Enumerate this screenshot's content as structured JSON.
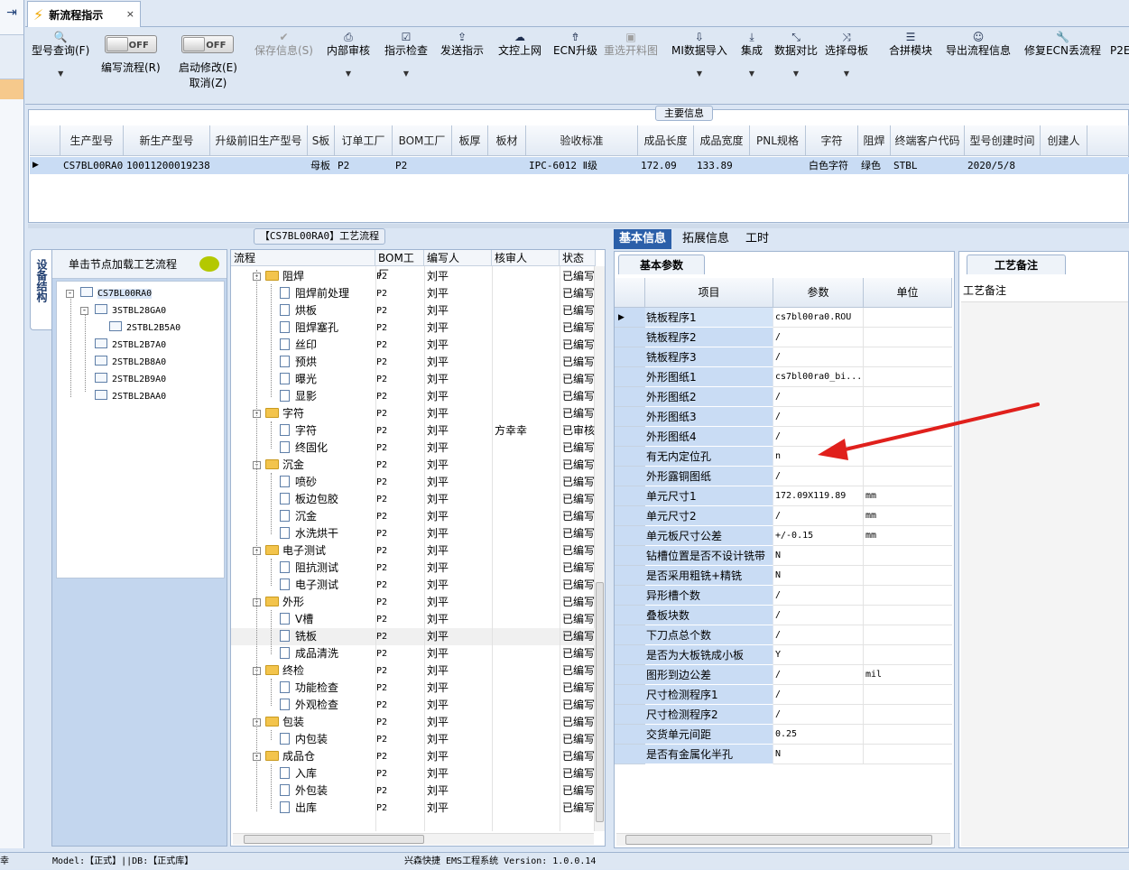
{
  "window": {
    "tab_title": "新流程指示",
    "tab_close": "×"
  },
  "toolbar": [
    {
      "label": "型号查询(F)",
      "icon": "search-icon",
      "glyph": "🔍",
      "arrow": true,
      "disabled": false
    },
    {
      "label": "编写流程(R)",
      "toggle": "OFF"
    },
    {
      "label": "启动修改(E)",
      "label2": "取消(Z)",
      "toggle": "OFF"
    },
    {
      "label": "保存信息(S)",
      "icon": "check-icon",
      "glyph": "✔",
      "disabled": true
    },
    {
      "label": "内部审核",
      "icon": "printer-icon",
      "glyph": "⎙",
      "arrow": true
    },
    {
      "label": "指示检查",
      "icon": "checklist-icon",
      "glyph": "☑",
      "arrow": true
    },
    {
      "label": "发送指示",
      "icon": "upload-icon",
      "glyph": "⇪"
    },
    {
      "label": "文控上网",
      "icon": "cloud-upload-icon",
      "glyph": "☁"
    },
    {
      "label": "ECN升级",
      "icon": "upgrade-icon",
      "glyph": "⇮"
    },
    {
      "label": "重选开料图",
      "icon": "image-icon",
      "glyph": "▣",
      "disabled": true
    },
    {
      "label": "MI数据导入",
      "icon": "download-icon",
      "glyph": "⇩",
      "arrow": true
    },
    {
      "label": "集成",
      "icon": "integrate-icon",
      "glyph": "⤓",
      "arrow": true
    },
    {
      "label": "数据对比",
      "icon": "compare-icon",
      "glyph": "⤡",
      "arrow": true
    },
    {
      "label": "选择母板",
      "icon": "shuffle-icon",
      "glyph": "⤨",
      "arrow": true
    },
    {
      "label": "合拼模块",
      "icon": "list-icon",
      "glyph": "☰"
    },
    {
      "label": "导出流程信息",
      "icon": "smile-icon",
      "glyph": "☺"
    },
    {
      "label": "修复ECN丢流程",
      "icon": "wrench-icon",
      "glyph": "🔧"
    },
    {
      "label": "P2E",
      "icon": "",
      "glyph": ""
    }
  ],
  "main_info": {
    "caption": "主要信息",
    "columns": [
      "生产型号",
      "新生产型号",
      "升级前旧生产型号",
      "S板",
      "订单工厂",
      "BOM工厂",
      "板厚",
      "板材",
      "验收标准",
      "成品长度",
      "成品宽度",
      "PNL规格",
      "字符",
      "阻焊",
      "终端客户代码",
      "型号创建时间",
      "创建人"
    ],
    "row": [
      "CS7BL00RA0",
      "10011200019238",
      "",
      "母板",
      "P2",
      "P2",
      "",
      "",
      "IPC-6012 Ⅱ级",
      "172.09",
      "133.89",
      "",
      "白色字符",
      "绿色",
      "STBL",
      "2020/5/8",
      ""
    ]
  },
  "left_pane": {
    "vertical_tab": "设备结构",
    "header": "单击节点加载工艺流程",
    "tree": [
      {
        "label": "CS7BL00RA0",
        "level": 0,
        "expander": "-",
        "selected": true
      },
      {
        "label": "3STBL28GA0",
        "level": 1,
        "expander": "-"
      },
      {
        "label": "2STBL2B5A0",
        "level": 2
      },
      {
        "label": "2STBL2B7A0",
        "level": 1
      },
      {
        "label": "2STBL2B8A0",
        "level": 1
      },
      {
        "label": "2STBL2B9A0",
        "level": 1
      },
      {
        "label": "2STBL2BAA0",
        "level": 1
      }
    ]
  },
  "process": {
    "caption": "【CS7BL00RA0】工艺流程",
    "columns": [
      "流程",
      "BOM工厂",
      "编写人",
      "核审人",
      "状态"
    ],
    "rows": [
      {
        "name": "阻焊",
        "folder": true,
        "bom": "P2",
        "writer": "刘平",
        "checker": "",
        "status": "已编写"
      },
      {
        "name": "阻焊前处理",
        "bom": "P2",
        "writer": "刘平",
        "checker": "",
        "status": "已编写"
      },
      {
        "name": "烘板",
        "bom": "P2",
        "writer": "刘平",
        "checker": "",
        "status": "已编写"
      },
      {
        "name": "阻焊塞孔",
        "bom": "P2",
        "writer": "刘平",
        "checker": "",
        "status": "已编写"
      },
      {
        "name": "丝印",
        "bom": "P2",
        "writer": "刘平",
        "checker": "",
        "status": "已编写"
      },
      {
        "name": "预烘",
        "bom": "P2",
        "writer": "刘平",
        "checker": "",
        "status": "已编写"
      },
      {
        "name": "曝光",
        "bom": "P2",
        "writer": "刘平",
        "checker": "",
        "status": "已编写"
      },
      {
        "name": "显影",
        "bom": "P2",
        "writer": "刘平",
        "checker": "",
        "status": "已编写"
      },
      {
        "name": "字符",
        "folder": true,
        "bom": "P2",
        "writer": "刘平",
        "checker": "",
        "status": "已编写"
      },
      {
        "name": "字符",
        "bom": "P2",
        "writer": "刘平",
        "checker": "方幸幸",
        "status": "已审核"
      },
      {
        "name": "终固化",
        "bom": "P2",
        "writer": "刘平",
        "checker": "",
        "status": "已编写"
      },
      {
        "name": "沉金",
        "folder": true,
        "bom": "P2",
        "writer": "刘平",
        "checker": "",
        "status": "已编写"
      },
      {
        "name": "喷砂",
        "bom": "P2",
        "writer": "刘平",
        "checker": "",
        "status": "已编写"
      },
      {
        "name": "板边包胶",
        "bom": "P2",
        "writer": "刘平",
        "checker": "",
        "status": "已编写"
      },
      {
        "name": "沉金",
        "bom": "P2",
        "writer": "刘平",
        "checker": "",
        "status": "已编写"
      },
      {
        "name": "水洗烘干",
        "bom": "P2",
        "writer": "刘平",
        "checker": "",
        "status": "已编写"
      },
      {
        "name": "电子测试",
        "folder": true,
        "bom": "P2",
        "writer": "刘平",
        "checker": "",
        "status": "已编写"
      },
      {
        "name": "阻抗测试",
        "bom": "P2",
        "writer": "刘平",
        "checker": "",
        "status": "已编写"
      },
      {
        "name": "电子测试",
        "bom": "P2",
        "writer": "刘平",
        "checker": "",
        "status": "已编写"
      },
      {
        "name": "外形",
        "folder": true,
        "bom": "P2",
        "writer": "刘平",
        "checker": "",
        "status": "已编写"
      },
      {
        "name": "V槽",
        "bom": "P2",
        "writer": "刘平",
        "checker": "",
        "status": "已编写"
      },
      {
        "name": "铣板",
        "bom": "P2",
        "writer": "刘平",
        "checker": "",
        "status": "已编写",
        "highlight": true
      },
      {
        "name": "成品清洗",
        "bom": "P2",
        "writer": "刘平",
        "checker": "",
        "status": "已编写"
      },
      {
        "name": "终检",
        "folder": true,
        "bom": "P2",
        "writer": "刘平",
        "checker": "",
        "status": "已编写"
      },
      {
        "name": "功能检查",
        "bom": "P2",
        "writer": "刘平",
        "checker": "",
        "status": "已编写"
      },
      {
        "name": "外观检查",
        "bom": "P2",
        "writer": "刘平",
        "checker": "",
        "status": "已编写"
      },
      {
        "name": "包装",
        "folder": true,
        "bom": "P2",
        "writer": "刘平",
        "checker": "",
        "status": "已编写"
      },
      {
        "name": "内包装",
        "bom": "P2",
        "writer": "刘平",
        "checker": "",
        "status": "已编写"
      },
      {
        "name": "成品仓",
        "folder": true,
        "bom": "P2",
        "writer": "刘平",
        "checker": "",
        "status": "已编写"
      },
      {
        "name": "入库",
        "bom": "P2",
        "writer": "刘平",
        "checker": "",
        "status": "已编写"
      },
      {
        "name": "外包装",
        "bom": "P2",
        "writer": "刘平",
        "checker": "",
        "status": "已编写"
      },
      {
        "name": "出库",
        "bom": "P2",
        "writer": "刘平",
        "checker": "",
        "status": "已编写"
      }
    ]
  },
  "right_tabs": [
    "基本信息",
    "拓展信息",
    "工时"
  ],
  "params": {
    "subtab": "基本参数",
    "columns": [
      "项目",
      "参数",
      "单位"
    ],
    "rows": [
      {
        "k": "铣板程序1",
        "v": "cs7bl00ra0.ROU",
        "u": ""
      },
      {
        "k": "铣板程序2",
        "v": "/",
        "u": ""
      },
      {
        "k": "铣板程序3",
        "v": "/",
        "u": ""
      },
      {
        "k": "外形图纸1",
        "v": "cs7bl00ra0_bi...",
        "u": ""
      },
      {
        "k": "外形图纸2",
        "v": "/",
        "u": ""
      },
      {
        "k": "外形图纸3",
        "v": "/",
        "u": ""
      },
      {
        "k": "外形图纸4",
        "v": "/",
        "u": ""
      },
      {
        "k": "有无内定位孔",
        "v": "n",
        "u": ""
      },
      {
        "k": "外形露铜图纸",
        "v": "/",
        "u": ""
      },
      {
        "k": "单元尺寸1",
        "v": "172.09X119.89",
        "u": "mm"
      },
      {
        "k": "单元尺寸2",
        "v": "/",
        "u": "mm"
      },
      {
        "k": "单元板尺寸公差",
        "v": "+/-0.15",
        "u": "mm"
      },
      {
        "k": "钻槽位置是否不设计铣带",
        "v": "N",
        "u": ""
      },
      {
        "k": "是否采用粗铣+精铣",
        "v": "N",
        "u": ""
      },
      {
        "k": "异形槽个数",
        "v": "/",
        "u": ""
      },
      {
        "k": "叠板块数",
        "v": "/",
        "u": ""
      },
      {
        "k": "下刀点总个数",
        "v": "/",
        "u": ""
      },
      {
        "k": "是否为大板铣成小板",
        "v": "Y",
        "u": ""
      },
      {
        "k": "图形到边公差",
        "v": "/",
        "u": "mil"
      },
      {
        "k": "尺寸检测程序1",
        "v": "/",
        "u": ""
      },
      {
        "k": "尺寸检测程序2",
        "v": "/",
        "u": ""
      },
      {
        "k": "交货单元间距",
        "v": "0.25",
        "u": ""
      },
      {
        "k": "是否有金属化半孔",
        "v": "N",
        "u": ""
      }
    ]
  },
  "remarks": {
    "subtab": "工艺备注",
    "label": "工艺备注"
  },
  "status_bar": {
    "left": "幸",
    "model": "Model:【正式】||DB:【正式库】",
    "app": "兴森快捷 EMS工程系统 Version: 1.0.0.14"
  },
  "annotation_color": "#e0201c"
}
